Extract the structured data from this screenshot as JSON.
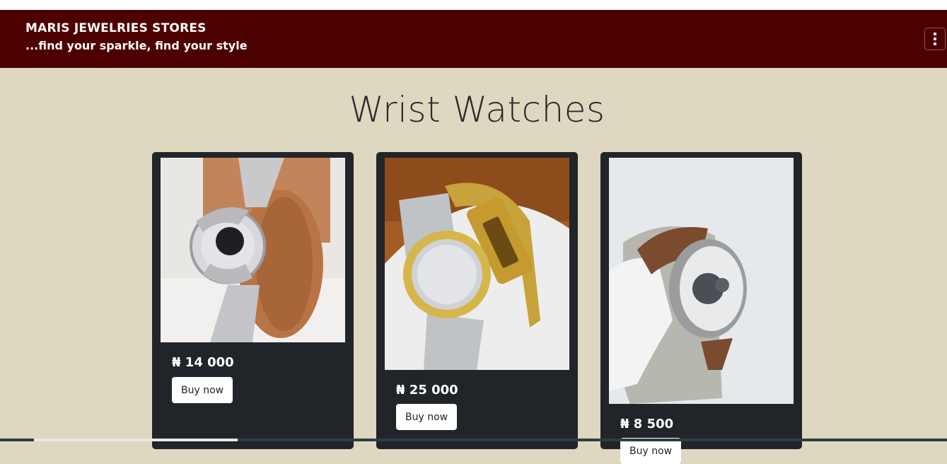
{
  "header": {
    "brand": "MARIS JEWELRIES STORES",
    "tagline": "...find your sparkle, find your style",
    "menu_icon": "vertical-dots-icon",
    "bg_color": "#4d0000"
  },
  "main": {
    "heading": "Wrist Watches",
    "products": [
      {
        "image": "silver crystal wristwatch on wooden stand",
        "price": "₦ 14 000",
        "button": "Buy now"
      },
      {
        "image": "two-tone gold and silver wristwatch with gold bracelet",
        "price": "₦ 25 000",
        "button": "Buy now"
      },
      {
        "image": "silver wristwatch with brown leather strap",
        "price": "₦ 8 500",
        "button": "Buy now"
      }
    ]
  },
  "colors": {
    "page_bg": "#ddd8bf",
    "card_bg": "#212529",
    "button_bg": "#ffffff"
  }
}
